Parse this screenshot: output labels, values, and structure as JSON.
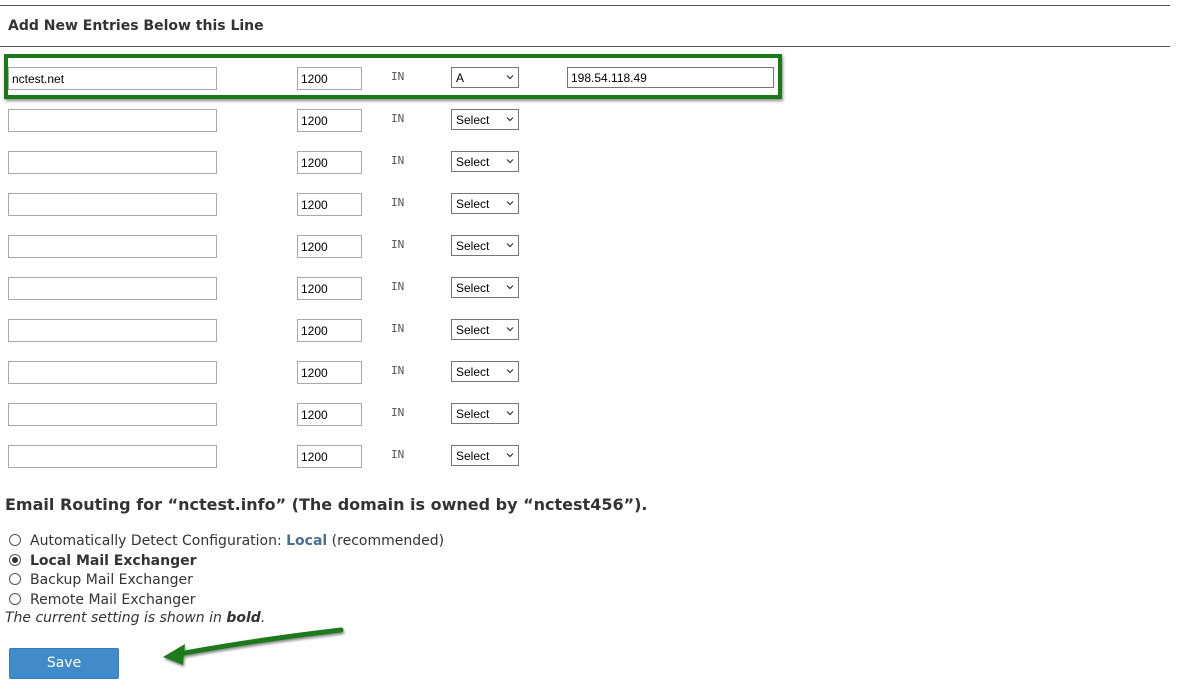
{
  "section": {
    "title": "Add New Entries Below this Line"
  },
  "entries": [
    {
      "name": "nctest.net",
      "ttl": "1200",
      "class": "IN",
      "type": "A",
      "value": "198.54.118.49"
    },
    {
      "name": "",
      "ttl": "1200",
      "class": "IN",
      "type": "Select"
    },
    {
      "name": "",
      "ttl": "1200",
      "class": "IN",
      "type": "Select"
    },
    {
      "name": "",
      "ttl": "1200",
      "class": "IN",
      "type": "Select"
    },
    {
      "name": "",
      "ttl": "1200",
      "class": "IN",
      "type": "Select"
    },
    {
      "name": "",
      "ttl": "1200",
      "class": "IN",
      "type": "Select"
    },
    {
      "name": "",
      "ttl": "1200",
      "class": "IN",
      "type": "Select"
    },
    {
      "name": "",
      "ttl": "1200",
      "class": "IN",
      "type": "Select"
    },
    {
      "name": "",
      "ttl": "1200",
      "class": "IN",
      "type": "Select"
    },
    {
      "name": "",
      "ttl": "1200",
      "class": "IN",
      "type": "Select"
    }
  ],
  "email_routing": {
    "heading": "Email Routing for “nctest.info” (The domain is owned by “nctest456”).",
    "options": {
      "auto": {
        "label_prefix": "Automatically Detect Configuration: ",
        "label_link": "Local",
        "label_suffix": " (recommended)",
        "checked": false
      },
      "local": {
        "label": "Local Mail Exchanger",
        "checked": true
      },
      "backup": {
        "label": "Backup Mail Exchanger",
        "checked": false
      },
      "remote": {
        "label": "Remote Mail Exchanger",
        "checked": false
      }
    },
    "note_prefix": "The current setting is shown in ",
    "note_bold": "bold",
    "note_suffix": "."
  },
  "save_button": {
    "label": "Save"
  },
  "annotation_color": "#1a7a1a",
  "button_color": "#428bca"
}
